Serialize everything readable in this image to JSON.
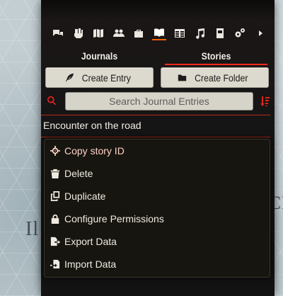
{
  "background": {
    "map_text_1": "Il",
    "map_text_2": "ICR"
  },
  "sidebar": {
    "icons": [
      "chat-icon",
      "dice-icon",
      "map-icon",
      "users-icon",
      "suitcase-icon",
      "book-icon",
      "table-icon",
      "music-icon",
      "compendium-icon",
      "settings-icon",
      "chevron-right-icon"
    ],
    "active_icon": "book-icon",
    "accent_color": "#ff6400"
  },
  "subtabs": [
    {
      "label": "Journals",
      "active": false
    },
    {
      "label": "Stories",
      "active": true
    }
  ],
  "actions": {
    "create_entry": "Create Entry",
    "create_folder": "Create Folder"
  },
  "search": {
    "placeholder": "Search Journal Entries",
    "value": ""
  },
  "entry": {
    "title": "Encounter on the road"
  },
  "context_menu": [
    {
      "label": "Copy story ID",
      "icon": "crosshair-icon",
      "highlighted": true
    },
    {
      "label": "Delete",
      "icon": "trash-icon"
    },
    {
      "label": "Duplicate",
      "icon": "copy-icon"
    },
    {
      "label": "Configure Permissions",
      "icon": "lock-icon"
    },
    {
      "label": "Export Data",
      "icon": "file-export-icon"
    },
    {
      "label": "Import Data",
      "icon": "file-import-icon"
    }
  ]
}
